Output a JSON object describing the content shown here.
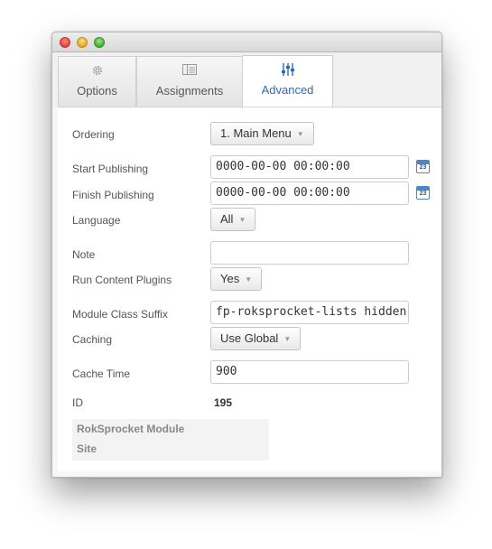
{
  "tabs": [
    {
      "label": "Options",
      "icon": "gear-icon",
      "active": false
    },
    {
      "label": "Assignments",
      "icon": "assignments-icon",
      "active": false
    },
    {
      "label": "Advanced",
      "icon": "sliders-icon",
      "active": true
    }
  ],
  "form": {
    "ordering": {
      "label": "Ordering",
      "value": "1. Main Menu"
    },
    "start_publishing": {
      "label": "Start Publishing",
      "value": "0000-00-00 00:00:00",
      "calendar_text": "23"
    },
    "finish_publishing": {
      "label": "Finish Publishing",
      "value": "0000-00-00 00:00:00",
      "calendar_text": "23"
    },
    "language": {
      "label": "Language",
      "value": "All"
    },
    "note": {
      "label": "Note",
      "value": ""
    },
    "run_content_plugins": {
      "label": "Run Content Plugins",
      "value": "Yes"
    },
    "module_class_suffix": {
      "label": "Module Class Suffix",
      "value": "fp-roksprocket-lists hidden-phone"
    },
    "caching": {
      "label": "Caching",
      "value": "Use Global"
    },
    "cache_time": {
      "label": "Cache Time",
      "value": "900"
    },
    "id": {
      "label": "ID",
      "value": "195"
    }
  },
  "info": {
    "module_name": "RokSprocket Module",
    "client": "Site"
  },
  "colors": {
    "active_tab_text": "#2a6bb8",
    "calendar_blue": "#4f85c2"
  }
}
